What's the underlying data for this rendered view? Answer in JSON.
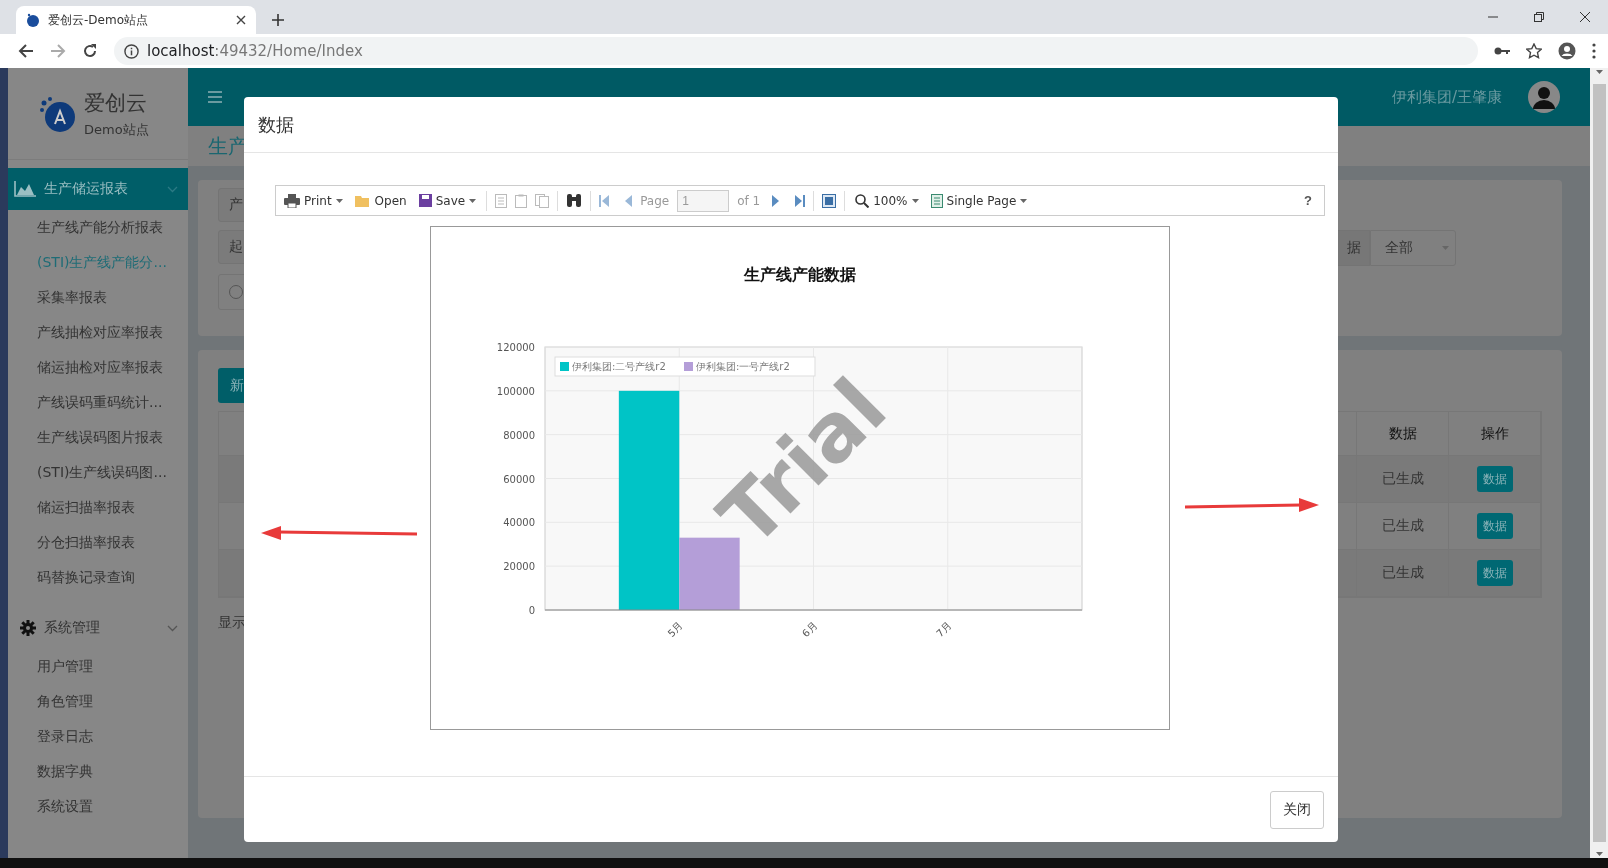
{
  "browser": {
    "tab_title": "爱创云-Demo站点",
    "address_host": "localhost",
    "address_path": ":49432/Home/Index"
  },
  "app": {
    "logo_name": "爱创云",
    "logo_sub": "Demo站点",
    "user": "伊利集团/王肇康",
    "page_heading": "生产"
  },
  "sidebar": {
    "groups": [
      {
        "label": "生产储运报表",
        "kind": "reports",
        "active": true,
        "expanded": true,
        "children": [
          {
            "label": "生产线产能分析报表",
            "selected": false
          },
          {
            "label": "(STI)生产线产能分...",
            "selected": true
          },
          {
            "label": "采集率报表",
            "selected": false
          },
          {
            "label": "产线抽检对应率报表",
            "selected": false
          },
          {
            "label": "储运抽检对应率报表",
            "selected": false
          },
          {
            "label": "产线误码重码统计...",
            "selected": false
          },
          {
            "label": "生产线误码图片报表",
            "selected": false
          },
          {
            "label": "(STI)生产线误码图...",
            "selected": false
          },
          {
            "label": "储运扫描率报表",
            "selected": false
          },
          {
            "label": "分仓扫描率报表",
            "selected": false
          },
          {
            "label": "码替换记录查询",
            "selected": false
          }
        ]
      },
      {
        "label": "系统管理",
        "kind": "settings",
        "active": false,
        "expanded": true,
        "children": [
          {
            "label": "用户管理",
            "selected": false
          },
          {
            "label": "角色管理",
            "selected": false
          },
          {
            "label": "登录日志",
            "selected": false
          },
          {
            "label": "数据字典",
            "selected": false
          },
          {
            "label": "系统设置",
            "selected": false
          }
        ]
      }
    ]
  },
  "filter": {
    "radio_checked": false,
    "fields": [
      "产",
      "起"
    ],
    "addon_label": "据",
    "select_value": "全部"
  },
  "list": {
    "new_button": "新",
    "columns": [
      "数据",
      "操作"
    ],
    "rows": [
      {
        "status": "已生成",
        "action": "数据"
      },
      {
        "status": "已生成",
        "action": "数据"
      },
      {
        "status": "已生成",
        "action": "数据"
      }
    ],
    "footer_text": "显示"
  },
  "modal": {
    "title": "数据",
    "close_button": "关闭",
    "toolbar": {
      "print": "Print",
      "open": "Open",
      "save": "Save",
      "page_label": "Page",
      "page_value": "1",
      "page_of": "of 1",
      "zoom": "100%",
      "view_mode": "Single Page",
      "help": "?"
    },
    "report": {
      "title": "生产线产能数据",
      "watermark": "Trial",
      "chart_data": {
        "type": "bar",
        "grid": true,
        "legend": "upper left",
        "categories": [
          "5月",
          "6月",
          "7月"
        ],
        "ylim": [
          0,
          120000
        ],
        "yticks": [
          0,
          20000,
          40000,
          60000,
          80000,
          100000,
          120000
        ],
        "series": [
          {
            "name": "伊利集团:二号产线r2",
            "color": "#00c4c6",
            "values": [
              100000,
              null,
              null
            ]
          },
          {
            "name": "伊利集团:一号产线r2",
            "color": "#b49ed8",
            "values": [
              33000,
              null,
              null
            ]
          }
        ]
      }
    }
  }
}
